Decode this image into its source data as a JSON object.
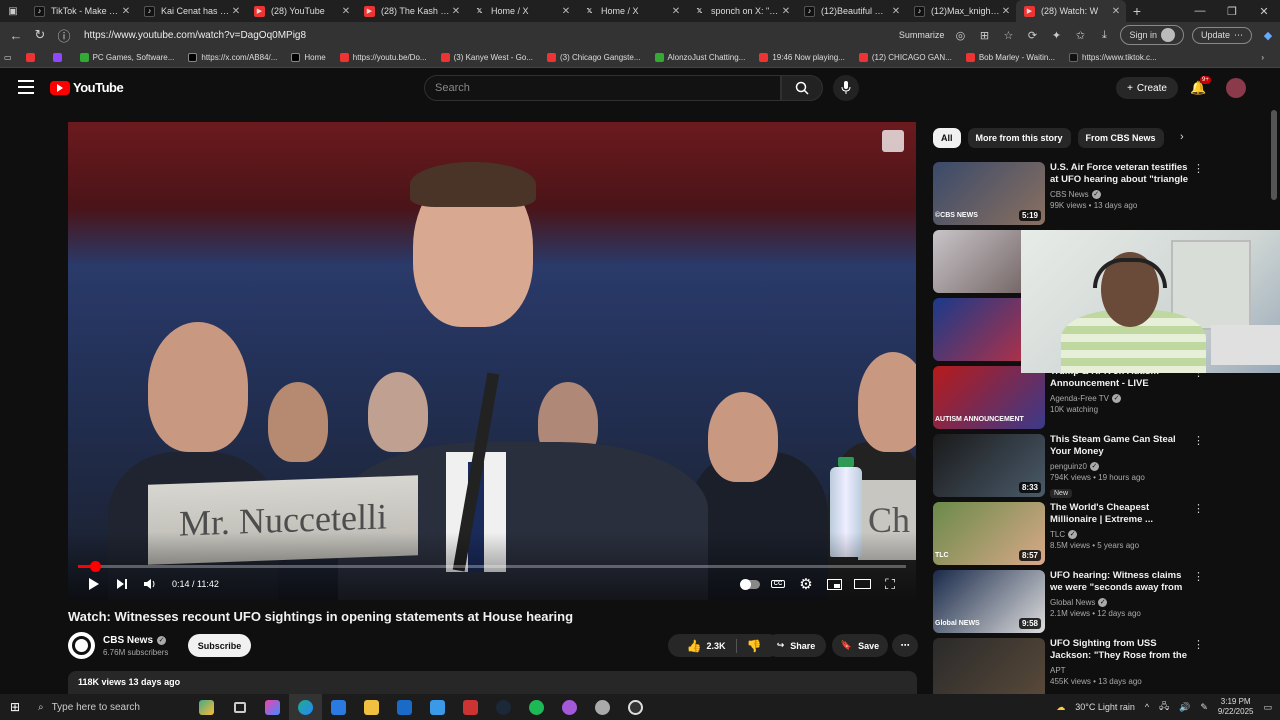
{
  "browser": {
    "tabs": [
      {
        "label": "TikTok - Make Your",
        "icon": "tiktok-icon"
      },
      {
        "label": "Kai Cenat has had E",
        "icon": "tiktok-icon"
      },
      {
        "label": "(28) YouTube",
        "icon": "youtube-icon"
      },
      {
        "label": "(28) The Kash Patel",
        "icon": "youtube-icon"
      },
      {
        "label": "Home / X",
        "icon": "x-icon"
      },
      {
        "label": "Home / X",
        "icon": "x-icon"
      },
      {
        "label": "sponch on X: \"Fram",
        "icon": "x-icon"
      },
      {
        "label": "(12)Beautiful Wedd",
        "icon": "tiktok-icon"
      },
      {
        "label": "(12)Max_knight (@",
        "icon": "tiktok-icon"
      },
      {
        "label": "(28) Watch: W",
        "icon": "youtube-icon",
        "active": true
      }
    ],
    "url": "https://www.youtube.com/watch?v=DagOq0MPig8",
    "summarize_label": "Summarize",
    "signin_label": "Sign in",
    "update_label": "Update",
    "bookmarks": [
      {
        "label": "",
        "icon": "youtube"
      },
      {
        "label": "",
        "icon": "twitch"
      },
      {
        "label": "PC Games, Software...",
        "icon": "green"
      },
      {
        "label": "https://x.com/AB84/...",
        "icon": "x"
      },
      {
        "label": "Home",
        "icon": "x"
      },
      {
        "label": "https://youtu.be/Do...",
        "icon": "youtube"
      },
      {
        "label": "(3) Kanye West - Go...",
        "icon": "youtube"
      },
      {
        "label": "(3) Chicago Gangste...",
        "icon": "youtube"
      },
      {
        "label": "AlonzoJust Chatting...",
        "icon": "green"
      },
      {
        "label": "19:46 Now playing...",
        "icon": "youtube"
      },
      {
        "label": "(12) CHICAGO GAN...",
        "icon": "youtube"
      },
      {
        "label": "Bob Marley - Waitin...",
        "icon": "youtube"
      },
      {
        "label": "https://www.tiktok.c...",
        "icon": "tiktok"
      }
    ]
  },
  "yt": {
    "logo_text": "YouTube",
    "search_placeholder": "Search",
    "create_label": "Create",
    "notification_count": "9+"
  },
  "player": {
    "nameplate": "Mr. Nuccetelli",
    "nameplate2": "Ch",
    "current_time": "0:14",
    "duration": "11:42",
    "time_display": "0:14 / 11:42",
    "progress_fraction": 0.02
  },
  "video": {
    "title": "Watch: Witnesses recount UFO sightings in opening statements at House hearing",
    "channel": "CBS News",
    "subscribers": "6.76M subscribers",
    "subscribe_label": "Subscribe",
    "likes": "2.3K",
    "share_label": "Share",
    "save_label": "Save",
    "views_date": "118K views  13 days ago"
  },
  "chips": [
    "All",
    "More from this story",
    "From CBS News"
  ],
  "recommendations": [
    {
      "title": "U.S. Air Force veteran testifies at UFO hearing about \"triangle ...",
      "channel": "CBS News",
      "verified": true,
      "stats": "99K views • 13 days ago",
      "duration": "5:19",
      "overlay": "©CBS NEWS",
      "colors": [
        "#3a4a6a",
        "#8a7060"
      ]
    },
    {
      "title": "",
      "channel": "",
      "verified": false,
      "stats": "",
      "duration": "",
      "overlay": "",
      "colors": [
        "#c8c4c8",
        "#6a5a5a"
      ]
    },
    {
      "title": "",
      "channel": "",
      "verified": false,
      "stats": "",
      "duration": "",
      "overlay": "",
      "colors": [
        "#1a3a8a",
        "#c23040"
      ]
    },
    {
      "title": "Trump & RFK Jr. Autism Announcement - LIVE Breakin...",
      "channel": "Agenda-Free TV",
      "verified": true,
      "stats": "10K watching",
      "duration": "",
      "overlay": "AUTISM ANNOUNCEMENT",
      "colors": [
        "#b81a1a",
        "#3a3a8a"
      ]
    },
    {
      "title": "This Steam Game Can Steal Your Money",
      "channel": "penguinz0",
      "verified": true,
      "stats": "794K views • 19 hours ago",
      "duration": "8:33",
      "badge": "New",
      "overlay": "",
      "colors": [
        "#1a1a1a",
        "#4a5a6a"
      ]
    },
    {
      "title": "The World's Cheapest Millionaire | Extreme ...",
      "channel": "TLC",
      "verified": true,
      "stats": "8.5M views • 5 years ago",
      "duration": "8:57",
      "overlay": "TLC",
      "colors": [
        "#6a8a4a",
        "#d8a888"
      ]
    },
    {
      "title": "UFO hearing: Witness claims we were \"seconds away from ...",
      "channel": "Global News",
      "verified": true,
      "stats": "2.1M views • 12 days ago",
      "duration": "9:58",
      "overlay": "Global NEWS",
      "colors": [
        "#1a2a4a",
        "#ddd"
      ]
    },
    {
      "title": "UFO Sighting from USS Jackson: \"They Rose from the ...",
      "channel": "APT",
      "verified": false,
      "stats": "455K views • 13 days ago",
      "duration": "",
      "overlay": "",
      "colors": [
        "#2a2a2a",
        "#5a4a3a"
      ]
    }
  ],
  "taskbar": {
    "search_placeholder": "Type here to search",
    "weather": "30°C  Light rain",
    "time": "3:19 PM",
    "date": "9/22/2025"
  },
  "colors": {
    "accent": "#ff0000",
    "bg": "#0f0f0f"
  }
}
